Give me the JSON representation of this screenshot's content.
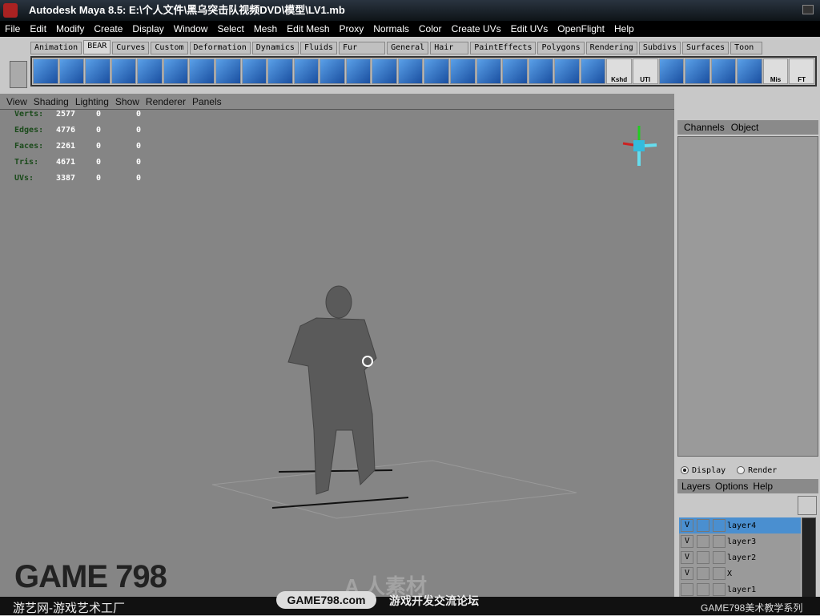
{
  "title": "Autodesk Maya 8.5: E:\\个人文件\\黑乌突击队视频DVD\\模型\\LV1.mb",
  "menu": [
    "File",
    "Edit",
    "Modify",
    "Create",
    "Display",
    "Window",
    "Select",
    "Mesh",
    "Edit Mesh",
    "Proxy",
    "Normals",
    "Color",
    "Create UVs",
    "Edit UVs",
    "OpenFlight",
    "Help"
  ],
  "shelf_tabs": [
    "Animation",
    "BEAR",
    "Curves",
    "Custom",
    "Deformation",
    "Dynamics",
    "Fluids",
    "Fur",
    "General",
    "Hair",
    "PaintEffects",
    "Polygons",
    "Rendering",
    "Subdivs",
    "Surfaces",
    "Toon"
  ],
  "active_shelf": "BEAR",
  "shelf_labels": {
    "kshd": "Kshd",
    "uti": "UTI",
    "mis": "Mis",
    "ft": "FT"
  },
  "viewport_menu": [
    "View",
    "Shading",
    "Lighting",
    "Show",
    "Renderer",
    "Panels"
  ],
  "stats": [
    {
      "label": "Verts:",
      "a": "2577",
      "b": "0",
      "c": "0"
    },
    {
      "label": "Edges:",
      "a": "4776",
      "b": "0",
      "c": "0"
    },
    {
      "label": "Faces:",
      "a": "2261",
      "b": "0",
      "c": "0"
    },
    {
      "label": "Tris:",
      "a": "4671",
      "b": "0",
      "c": "0"
    },
    {
      "label": "UVs:",
      "a": "3387",
      "b": "0",
      "c": "0"
    }
  ],
  "channel_box": {
    "menu": [
      "Channels",
      "Object"
    ]
  },
  "layer_editor": {
    "modes": [
      "Display",
      "Render"
    ],
    "selected_mode": "Display",
    "menu": [
      "Layers",
      "Options",
      "Help"
    ],
    "layers": [
      {
        "v": "V",
        "name": "layer4",
        "selected": true
      },
      {
        "v": "V",
        "name": "layer3"
      },
      {
        "v": "V",
        "name": "layer2"
      },
      {
        "v": "V",
        "name": "X"
      },
      {
        "v": "",
        "name": "layer1"
      }
    ]
  },
  "watermark": {
    "logo": "GAME 798",
    "sub": "游艺网-游戏艺术工厂",
    "pill": "GAME798.com",
    "forum": "游戏开发交流论坛",
    "series": "GAME798美术教学系列",
    "center": "A 人素材"
  }
}
